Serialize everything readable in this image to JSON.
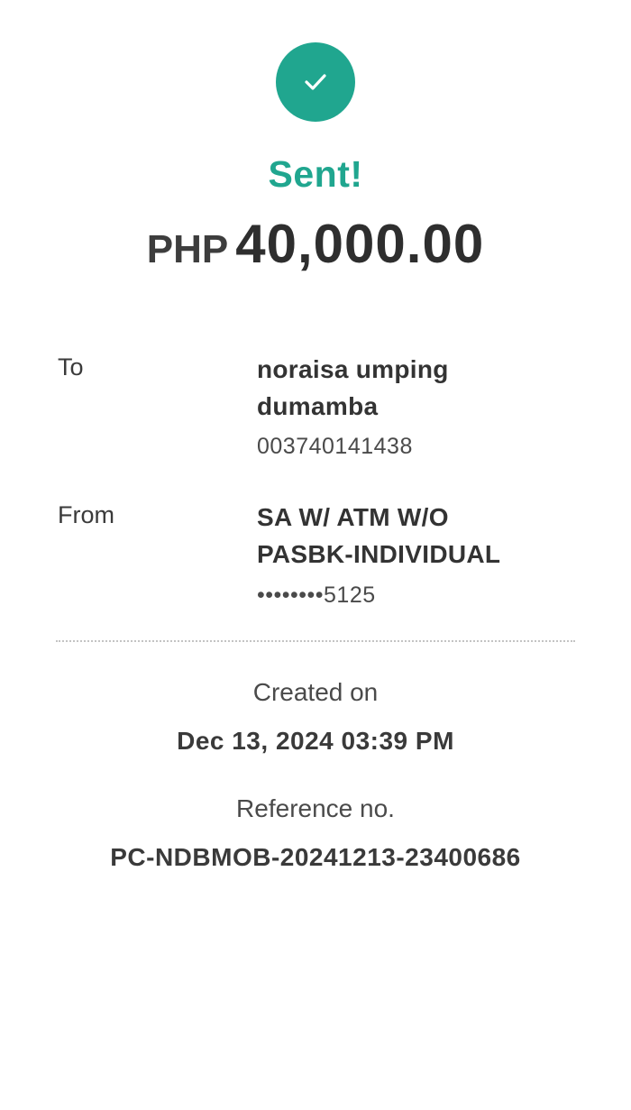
{
  "status": {
    "icon": "checkmark-icon",
    "title": "Sent!",
    "accent_color": "#20a68f"
  },
  "amount": {
    "currency": "PHP",
    "value": "40,000.00"
  },
  "details": {
    "to": {
      "label": "To",
      "name_line1": "noraisa umping",
      "name_line2": "dumamba",
      "account": "003740141438"
    },
    "from": {
      "label": "From",
      "name_line1": "SA W/ ATM W/O",
      "name_line2": "PASBK-INDIVIDUAL",
      "account": "••••••••5125"
    }
  },
  "meta": {
    "created_label": "Created on",
    "created_value": "Dec 13, 2024 03:39 PM",
    "reference_label": "Reference no.",
    "reference_value": "PC-NDBMOB-20241213-23400686"
  }
}
